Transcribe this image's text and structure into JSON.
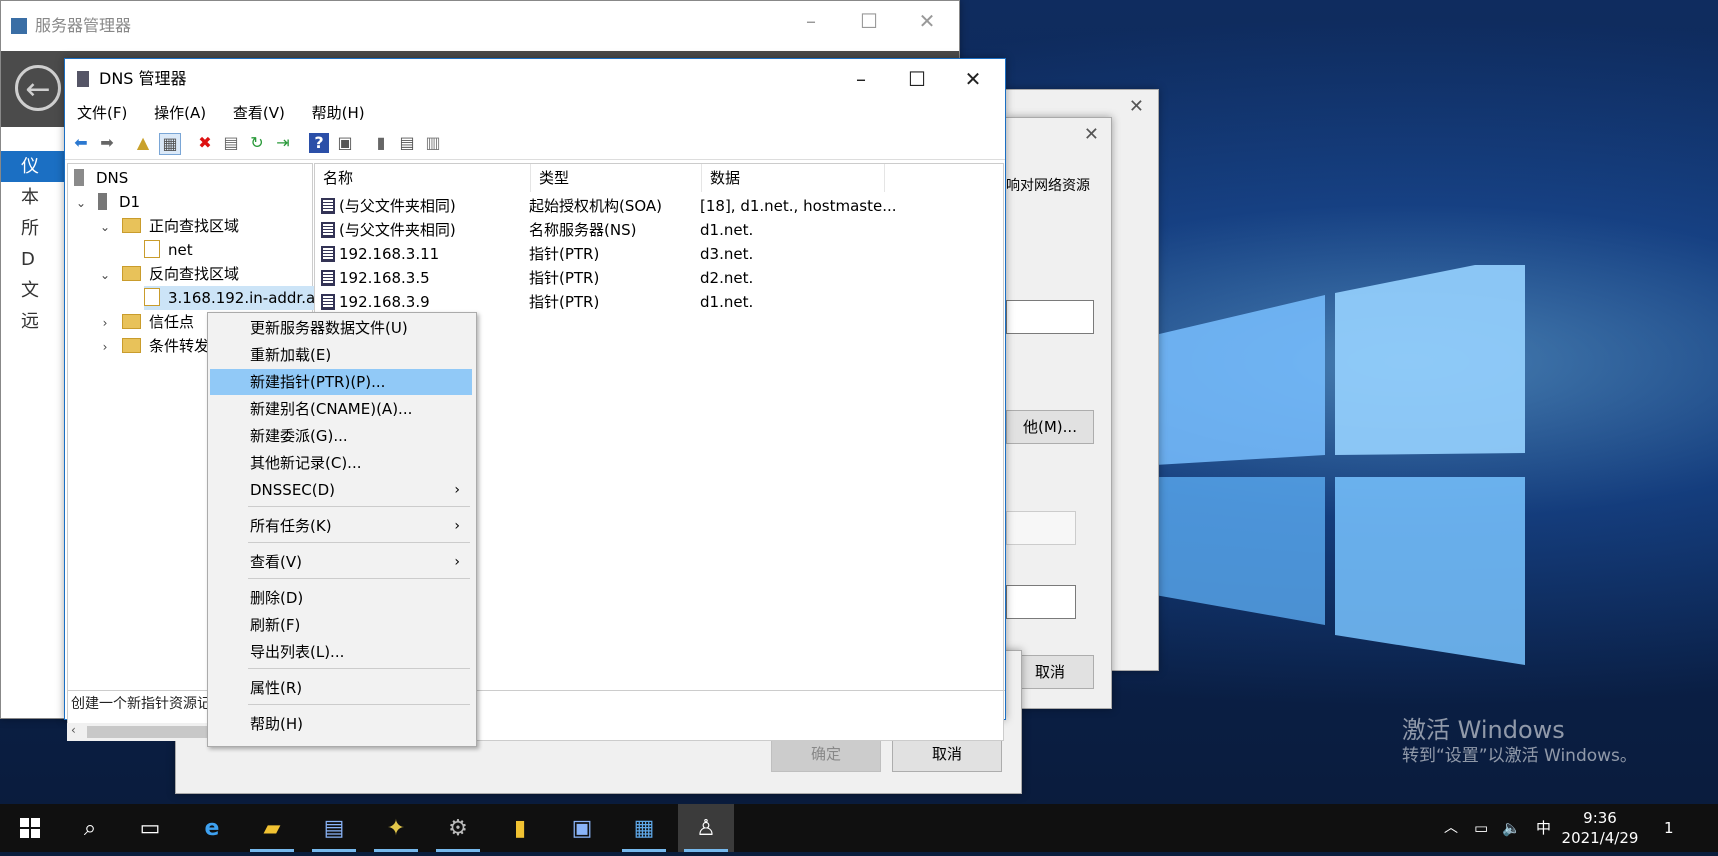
{
  "desktop": {
    "activation_title": "激活 Windows",
    "activation_sub": "转到“设置”以激活 Windows。"
  },
  "server_manager": {
    "title": "服务器管理器",
    "nav": [
      "仪",
      "本",
      "所",
      "D",
      "文",
      "远"
    ]
  },
  "bg_dialog": {
    "text_resource": "响对网络资源",
    "other_button": "他(M)...",
    "cancel_small": "取消"
  },
  "dialog_c": {
    "ok": "确定",
    "cancel": "取消"
  },
  "dns": {
    "title": "DNS 管理器",
    "menu": [
      "文件(F)",
      "操作(A)",
      "查看(V)",
      "帮助(H)"
    ],
    "tree": {
      "root": "DNS",
      "server": "D1",
      "forward": "正向查找区域",
      "forward_child": "net",
      "reverse": "反向查找区域",
      "reverse_child": "3.168.192.in-addr.a",
      "trust": "信任点",
      "cond": "条件转发"
    },
    "columns": [
      "名称",
      "类型",
      "数据"
    ],
    "rows": [
      {
        "name": "(与父文件夹相同)",
        "type": "起始授权机构(SOA)",
        "data": "[18], d1.net., hostmaste..."
      },
      {
        "name": "(与父文件夹相同)",
        "type": "名称服务器(NS)",
        "data": "d1.net."
      },
      {
        "name": "192.168.3.11",
        "type": "指针(PTR)",
        "data": "d3.net."
      },
      {
        "name": "192.168.3.5",
        "type": "指针(PTR)",
        "data": "d2.net."
      },
      {
        "name": "192.168.3.9",
        "type": "指针(PTR)",
        "data": "d1.net."
      }
    ],
    "status": "创建一个新指针资源记"
  },
  "context_menu": {
    "items": [
      "更新服务器数据文件(U)",
      "重新加载(E)",
      "新建指针(PTR)(P)...",
      "新建别名(CNAME)(A)...",
      "新建委派(G)...",
      "其他新记录(C)...",
      "DNSSEC(D)",
      "所有任务(K)",
      "查看(V)",
      "删除(D)",
      "刷新(F)",
      "导出列表(L)...",
      "属性(R)",
      "帮助(H)"
    ],
    "highlighted_index": 2
  },
  "taskbar": {
    "time": "9:36",
    "date": "2021/4/29",
    "ime": "中",
    "notification_count": "1"
  }
}
